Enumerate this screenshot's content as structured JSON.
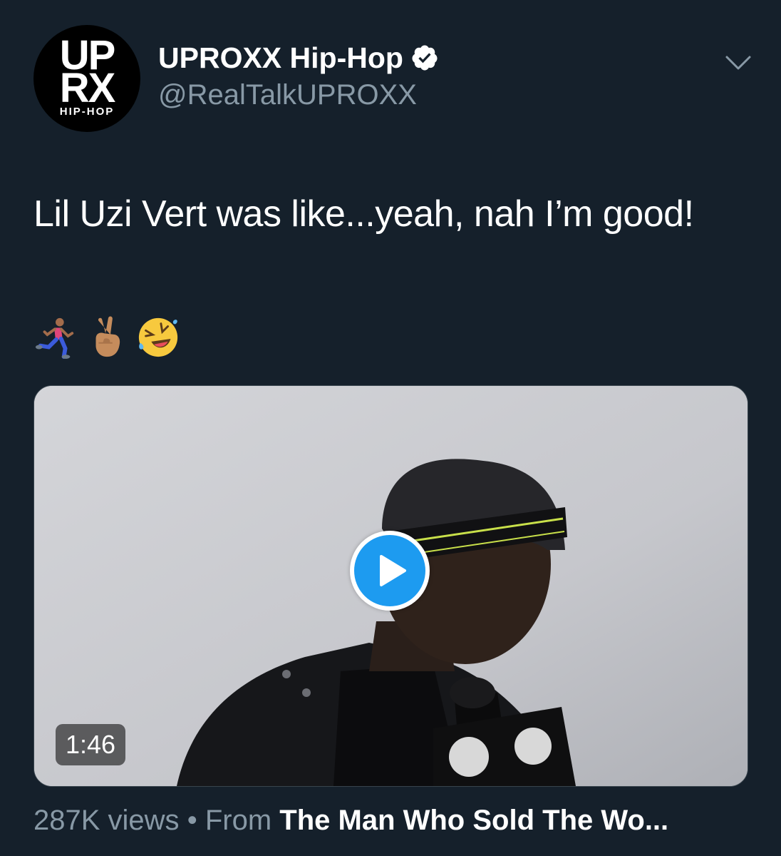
{
  "account": {
    "display_name": "UPROXX Hip-Hop",
    "handle": "@RealTalkUPROXX",
    "verified": true,
    "avatar_logo": {
      "line1": "UP",
      "line2": "RX",
      "subtitle": "HIP-HOP"
    }
  },
  "menu": {
    "icon": "chevron-down-icon"
  },
  "tweet": {
    "text": "Lil Uzi Vert was like...yeah, nah I’m good!",
    "emojis": [
      "person-running-emoji",
      "victory-hand-emoji",
      "rolling-on-floor-laughing-emoji"
    ]
  },
  "video": {
    "duration": "1:46",
    "play_icon": "play-icon"
  },
  "footer": {
    "views": "287K views",
    "separator": "•",
    "from_label": "From",
    "from_title": "The Man Who Sold The Wo..."
  },
  "colors": {
    "background": "#15202b",
    "secondary_text": "#8899a6",
    "accent": "#1d9bf0",
    "border": "#38444d"
  }
}
